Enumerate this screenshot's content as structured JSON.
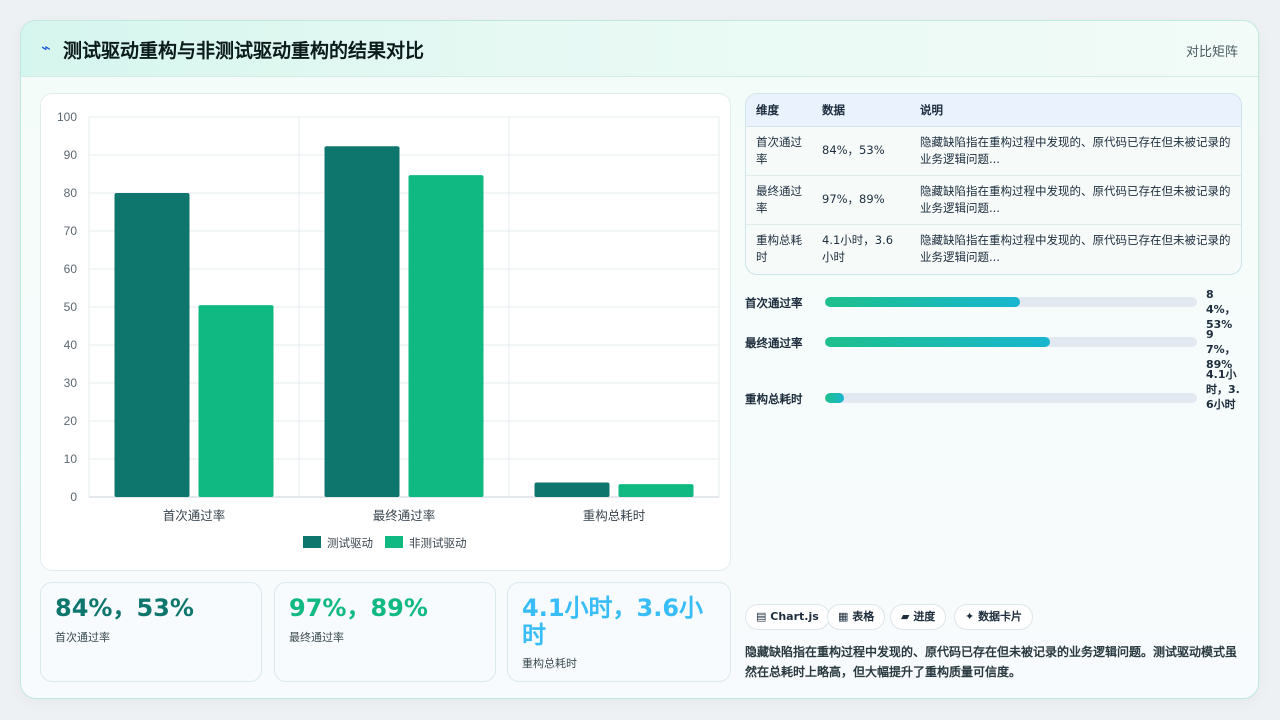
{
  "header": {
    "icon": "wave-icon",
    "title": "测试驱动重构与非测试驱动重构的结果对比",
    "link": "对比矩阵"
  },
  "chart_data": {
    "type": "bar",
    "categories": [
      "首次通过率",
      "最终通过率",
      "重构总耗时"
    ],
    "series": [
      {
        "name": "测试驱动",
        "values": [
          80,
          92.3,
          3.8
        ],
        "color": "#0f766e"
      },
      {
        "name": "非测试驱动",
        "values": [
          50.5,
          84.7,
          3.4
        ],
        "color": "#10b981"
      }
    ],
    "ylim": [
      0,
      100
    ],
    "yticks": [
      0,
      10,
      20,
      30,
      40,
      50,
      60,
      70,
      80,
      90,
      100
    ],
    "grid": true,
    "legend": "bottom"
  },
  "table": {
    "headers": [
      "维度",
      "数据",
      "说明"
    ],
    "rows": [
      [
        "首次通过率",
        "84%，53%",
        "隐藏缺陷指在重构过程中发现的、原代码已存在但未被记录的业务逻辑问题..."
      ],
      [
        "最终通过率",
        "97%，89%",
        "隐藏缺陷指在重构过程中发现的、原代码已存在但未被记录的业务逻辑问题..."
      ],
      [
        "重构总耗时",
        "4.1小时，3.6小时",
        "隐藏缺陷指在重构过程中发现的、原代码已存在但未被记录的业务逻辑问题..."
      ]
    ]
  },
  "progress": [
    {
      "label": "首次通过率",
      "value": "84%，53%",
      "fraction": 0.524
    },
    {
      "label": "最终通过率",
      "value": "97%，89%",
      "fraction": 0.605
    },
    {
      "label": "重构总耗时",
      "value": "4.1小时，3.6小时",
      "fraction": 0.05
    }
  ],
  "stats": [
    {
      "value": "84%，53%",
      "label": "首次通过率",
      "color": "#0f766e"
    },
    {
      "value": "97%，89%",
      "label": "最终通过率",
      "color": "#10b981"
    },
    {
      "value": "4.1小时，3.6小时",
      "label": "重构总耗时",
      "color": "#38bdf8"
    }
  ],
  "chips": [
    {
      "icon": "chart-icon",
      "glyph": "▤",
      "label": "Chart.js"
    },
    {
      "icon": "table-icon",
      "glyph": "▦",
      "label": "表格"
    },
    {
      "icon": "progress-icon",
      "glyph": "▰",
      "label": "进度"
    },
    {
      "icon": "sparkle-icon",
      "glyph": "✦",
      "label": "数据卡片"
    }
  ],
  "note": "隐藏缺陷指在重构过程中发现的、原代码已存在但未被记录的业务逻辑问题。测试驱动模式虽然在总耗时上略高，但大幅提升了重构质量可信度。"
}
